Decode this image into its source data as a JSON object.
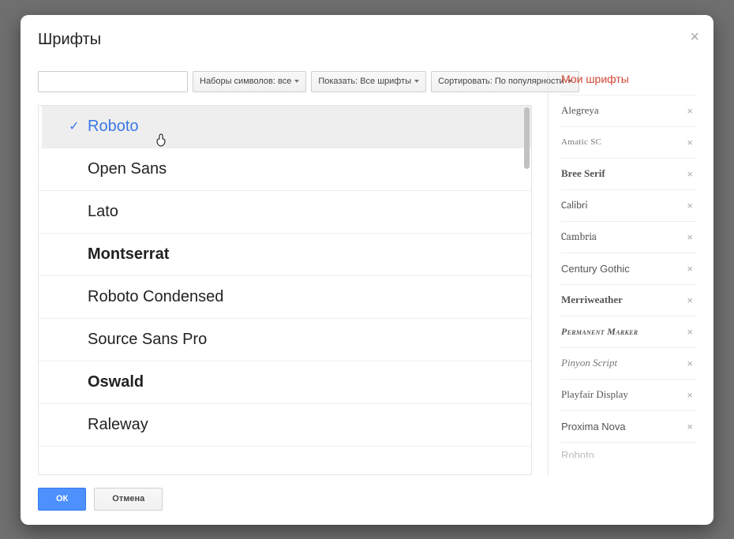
{
  "dialog": {
    "title": "Шрифты",
    "close_glyph": "×"
  },
  "filters": {
    "search_value": "",
    "charset_label": "Наборы символов: все",
    "show_label": "Показать: Все шрифты",
    "sort_label": "Сортировать: По популярности"
  },
  "font_list": [
    {
      "label": "Roboto",
      "selected": true,
      "class": "ff-roboto"
    },
    {
      "label": "Open Sans",
      "selected": false,
      "class": "ff-opensans"
    },
    {
      "label": "Lato",
      "selected": false,
      "class": "ff-lato"
    },
    {
      "label": "Montserrat",
      "selected": false,
      "class": "ff-montserrat"
    },
    {
      "label": "Roboto Condensed",
      "selected": false,
      "class": "ff-robotocond"
    },
    {
      "label": "Source Sans Pro",
      "selected": false,
      "class": "ff-sourcesans"
    },
    {
      "label": "Oswald",
      "selected": false,
      "class": "ff-oswald"
    },
    {
      "label": "Raleway",
      "selected": false,
      "class": "ff-raleway"
    }
  ],
  "check_glyph": "✓",
  "my_fonts": {
    "title": "Мои шрифты",
    "remove_glyph": "×",
    "items": [
      {
        "label": "Alegreya",
        "class": "mf-alegreya"
      },
      {
        "label": "Amatic SC",
        "class": "mf-amatic"
      },
      {
        "label": "Bree Serif",
        "class": "mf-bree"
      },
      {
        "label": "Calibri",
        "class": "mf-calibri"
      },
      {
        "label": "Cambria",
        "class": "mf-cambria"
      },
      {
        "label": "Century Gothic",
        "class": "mf-century"
      },
      {
        "label": "Merriweather",
        "class": "mf-merri"
      },
      {
        "label": "Permanent Marker",
        "class": "mf-perm"
      },
      {
        "label": "Pinyon Script",
        "class": "mf-pinyon"
      },
      {
        "label": "Playfair Display",
        "class": "mf-playfair"
      },
      {
        "label": "Proxima Nova",
        "class": "mf-proxima"
      }
    ],
    "cutoff": {
      "label": "Roboto",
      "class": "mf-cutoff"
    }
  },
  "footer": {
    "ok_label": "ОК",
    "cancel_label": "Отмена"
  },
  "cursor_glyph": "☟"
}
